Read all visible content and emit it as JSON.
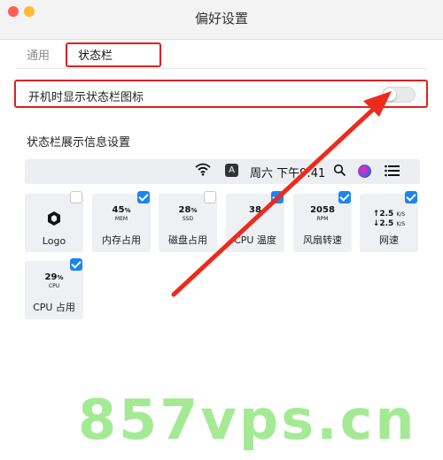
{
  "window": {
    "title": "偏好设置"
  },
  "tabs": [
    {
      "label": "通用"
    },
    {
      "label": "状态栏"
    }
  ],
  "toggle": {
    "label": "开机时显示状态栏图标",
    "on": false
  },
  "section": {
    "title": "状态栏展示信息设置"
  },
  "menubar": {
    "icons": [
      "wifi-icon",
      "input-source-icon",
      "search-icon",
      "siri-icon",
      "control-center-icon"
    ],
    "input_source": "A",
    "datetime": "周六 下午9:41"
  },
  "tiles": [
    {
      "label": "Logo",
      "checked": false,
      "preview": {
        "kind": "logo"
      }
    },
    {
      "label": "内存占用",
      "checked": true,
      "preview": {
        "value": "45",
        "unit": "%",
        "sub": "MEM"
      }
    },
    {
      "label": "磁盘占用",
      "checked": false,
      "preview": {
        "value": "28",
        "unit": "%",
        "sub": "SSD"
      }
    },
    {
      "label": "CPU 温度",
      "checked": true,
      "preview": {
        "value": "38",
        "unit": "",
        "sub": ""
      }
    },
    {
      "label": "风扇转速",
      "checked": true,
      "preview": {
        "value": "2058",
        "unit": "",
        "sub": "RPM"
      }
    },
    {
      "label": "网速",
      "checked": true,
      "preview": {
        "up": "2.5",
        "down": "2.5",
        "unit": "K/S"
      }
    },
    {
      "label": "CPU 占用",
      "checked": true,
      "preview": {
        "value": "29",
        "unit": "%",
        "sub": "CPU"
      }
    }
  ],
  "watermark": "857vps.cn",
  "colors": {
    "highlight": "#e02020",
    "checkbox": "#1a85f0",
    "watermark": "#9be88a"
  }
}
